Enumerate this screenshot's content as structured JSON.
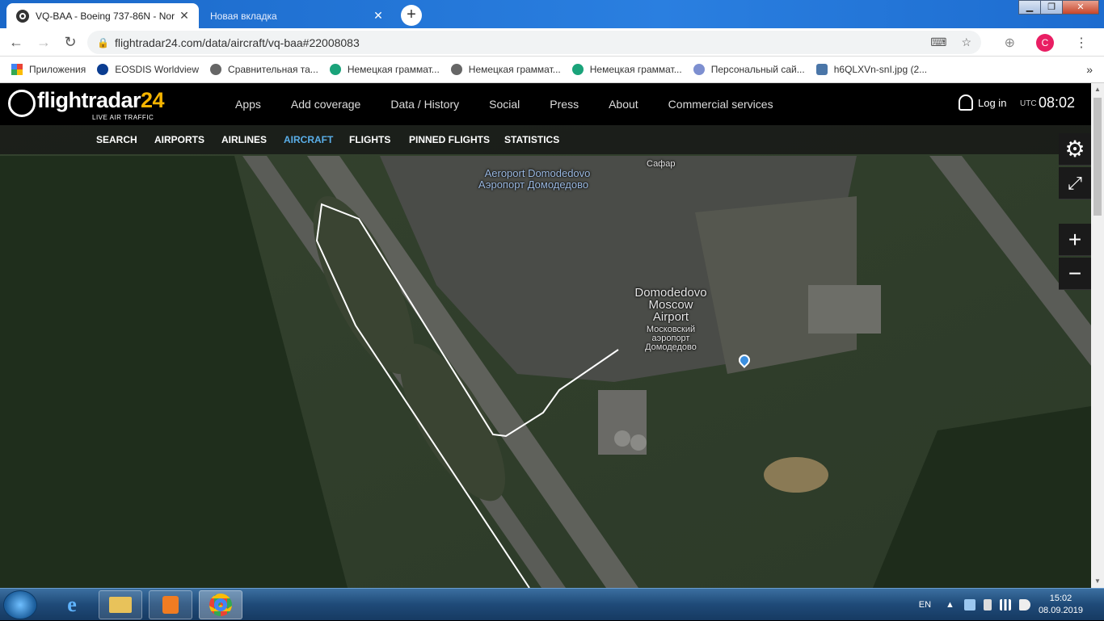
{
  "browser": {
    "tabs": [
      {
        "title": "VQ-BAA - Boeing 737-86N - Nor",
        "close": "✕"
      },
      {
        "title": "Новая вкладка",
        "close": "✕"
      }
    ],
    "new_tab": "+",
    "url": "flightradar24.com/data/aircraft/vq-baa#22008083",
    "avatar_letter": "C",
    "bookmarks": [
      {
        "label": "Приложения"
      },
      {
        "label": "EOSDIS Worldview"
      },
      {
        "label": "Сравнительная та..."
      },
      {
        "label": "Немецкая граммат..."
      },
      {
        "label": "Немецкая граммат..."
      },
      {
        "label": "Немецкая граммат..."
      },
      {
        "label": "Персональный сай..."
      },
      {
        "label": "h6QLXVn-snI.jpg (2..."
      }
    ],
    "bookmarks_more": "»"
  },
  "site": {
    "logo_main": "flightradar",
    "logo_num": "24",
    "logo_sub": "LIVE AIR TRAFFIC",
    "nav": [
      "Apps",
      "Add coverage",
      "Data / History",
      "Social",
      "Press",
      "About",
      "Commercial services"
    ],
    "login": "Log in",
    "utc_label": "UTC",
    "clock": "08:02",
    "subnav": [
      "SEARCH",
      "AIRPORTS",
      "AIRLINES",
      "AIRCRAFT",
      "FLIGHTS",
      "PINNED FLIGHTS",
      "STATISTICS"
    ],
    "subnav_active": "AIRCRAFT",
    "controls": {
      "settings": "⚙",
      "fullscreen": "⤢",
      "zoom_in": "+",
      "zoom_out": "−"
    }
  },
  "map": {
    "labels": {
      "aeroport_lat": "Aeroport Domodedovo",
      "aeroport_ru": "Аэропорт Домодедово",
      "safar": "Сафар",
      "airport_title": "Domodedovo\nMoscow\nAirport",
      "airport_ru": "Московский\nаэропорт\nДомодедово"
    },
    "colors": {
      "track": "#ffffff",
      "pin": "#3b8fe0"
    }
  },
  "taskbar": {
    "lang": "EN",
    "time": "15:02",
    "date": "08.09.2019"
  }
}
